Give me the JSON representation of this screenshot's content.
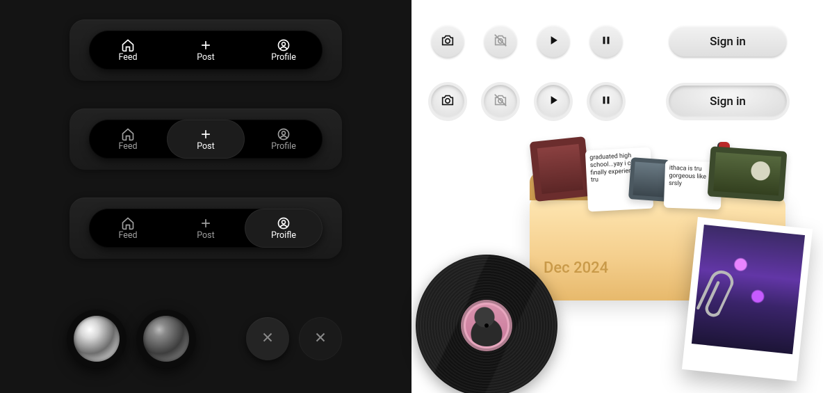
{
  "dark": {
    "tabs": {
      "feed": "Feed",
      "post": "Post",
      "profile": "Profile",
      "profile_typo": "Proifle"
    }
  },
  "light": {
    "signin": "Sign in",
    "folder_label": "Dec 2024",
    "note1": "graduated high school...yay i can finally experience tru",
    "note2": "ithaca is tru gorgeous like srsly"
  }
}
